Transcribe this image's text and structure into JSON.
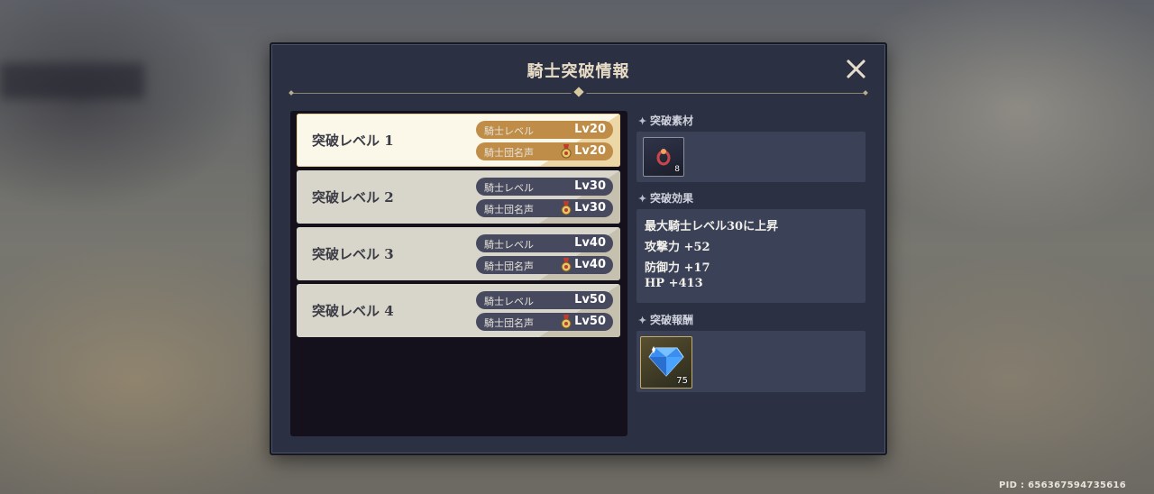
{
  "modal": {
    "title": "騎士突破情報",
    "close_icon": "close-icon"
  },
  "levels": [
    {
      "label": "突破レベル 1",
      "knight_level_label": "騎士レベル",
      "knight_level": "Lv20",
      "renown_label": "騎士団名声",
      "renown_level": "Lv20",
      "selected": true
    },
    {
      "label": "突破レベル 2",
      "knight_level_label": "騎士レベル",
      "knight_level": "Lv30",
      "renown_label": "騎士団名声",
      "renown_level": "Lv30",
      "selected": false
    },
    {
      "label": "突破レベル 3",
      "knight_level_label": "騎士レベル",
      "knight_level": "Lv40",
      "renown_label": "騎士団名声",
      "renown_level": "Lv40",
      "selected": false
    },
    {
      "label": "突破レベル 4",
      "knight_level_label": "騎士レベル",
      "knight_level": "Lv50",
      "renown_label": "騎士団名声",
      "renown_level": "Lv50",
      "selected": false
    }
  ],
  "materials": {
    "heading": "突破素材",
    "items": [
      {
        "icon": "ring-icon",
        "count": "8"
      }
    ]
  },
  "effects": {
    "heading": "突破効果",
    "lines": [
      "最大騎士レベル30に上昇",
      "攻撃力 +52",
      "防御力 +17",
      "HP +413"
    ]
  },
  "rewards": {
    "heading": "突破報酬",
    "items": [
      {
        "icon": "diamond-icon",
        "count": "75"
      }
    ]
  },
  "footer": {
    "pid": "PID : 656367594735616"
  },
  "colors": {
    "modal_bg": "#2b3043",
    "active_row": "#fbf8ea",
    "pill_gold": "#bf8d47",
    "pill_dark": "#474a5f"
  }
}
